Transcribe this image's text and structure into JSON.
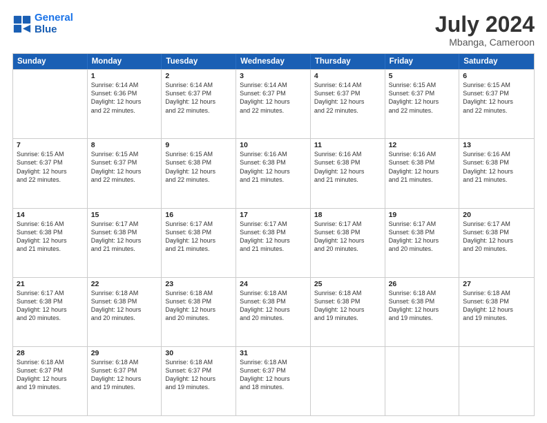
{
  "logo": {
    "line1": "General",
    "line2": "Blue"
  },
  "title": "July 2024",
  "location": "Mbanga, Cameroon",
  "days_of_week": [
    "Sunday",
    "Monday",
    "Tuesday",
    "Wednesday",
    "Thursday",
    "Friday",
    "Saturday"
  ],
  "weeks": [
    [
      {
        "day": "",
        "info": ""
      },
      {
        "day": "1",
        "info": "Sunrise: 6:14 AM\nSunset: 6:36 PM\nDaylight: 12 hours\nand 22 minutes."
      },
      {
        "day": "2",
        "info": "Sunrise: 6:14 AM\nSunset: 6:37 PM\nDaylight: 12 hours\nand 22 minutes."
      },
      {
        "day": "3",
        "info": "Sunrise: 6:14 AM\nSunset: 6:37 PM\nDaylight: 12 hours\nand 22 minutes."
      },
      {
        "day": "4",
        "info": "Sunrise: 6:14 AM\nSunset: 6:37 PM\nDaylight: 12 hours\nand 22 minutes."
      },
      {
        "day": "5",
        "info": "Sunrise: 6:15 AM\nSunset: 6:37 PM\nDaylight: 12 hours\nand 22 minutes."
      },
      {
        "day": "6",
        "info": "Sunrise: 6:15 AM\nSunset: 6:37 PM\nDaylight: 12 hours\nand 22 minutes."
      }
    ],
    [
      {
        "day": "7",
        "info": "Sunrise: 6:15 AM\nSunset: 6:37 PM\nDaylight: 12 hours\nand 22 minutes."
      },
      {
        "day": "8",
        "info": "Sunrise: 6:15 AM\nSunset: 6:37 PM\nDaylight: 12 hours\nand 22 minutes."
      },
      {
        "day": "9",
        "info": "Sunrise: 6:15 AM\nSunset: 6:38 PM\nDaylight: 12 hours\nand 22 minutes."
      },
      {
        "day": "10",
        "info": "Sunrise: 6:16 AM\nSunset: 6:38 PM\nDaylight: 12 hours\nand 21 minutes."
      },
      {
        "day": "11",
        "info": "Sunrise: 6:16 AM\nSunset: 6:38 PM\nDaylight: 12 hours\nand 21 minutes."
      },
      {
        "day": "12",
        "info": "Sunrise: 6:16 AM\nSunset: 6:38 PM\nDaylight: 12 hours\nand 21 minutes."
      },
      {
        "day": "13",
        "info": "Sunrise: 6:16 AM\nSunset: 6:38 PM\nDaylight: 12 hours\nand 21 minutes."
      }
    ],
    [
      {
        "day": "14",
        "info": "Sunrise: 6:16 AM\nSunset: 6:38 PM\nDaylight: 12 hours\nand 21 minutes."
      },
      {
        "day": "15",
        "info": "Sunrise: 6:17 AM\nSunset: 6:38 PM\nDaylight: 12 hours\nand 21 minutes."
      },
      {
        "day": "16",
        "info": "Sunrise: 6:17 AM\nSunset: 6:38 PM\nDaylight: 12 hours\nand 21 minutes."
      },
      {
        "day": "17",
        "info": "Sunrise: 6:17 AM\nSunset: 6:38 PM\nDaylight: 12 hours\nand 21 minutes."
      },
      {
        "day": "18",
        "info": "Sunrise: 6:17 AM\nSunset: 6:38 PM\nDaylight: 12 hours\nand 20 minutes."
      },
      {
        "day": "19",
        "info": "Sunrise: 6:17 AM\nSunset: 6:38 PM\nDaylight: 12 hours\nand 20 minutes."
      },
      {
        "day": "20",
        "info": "Sunrise: 6:17 AM\nSunset: 6:38 PM\nDaylight: 12 hours\nand 20 minutes."
      }
    ],
    [
      {
        "day": "21",
        "info": "Sunrise: 6:17 AM\nSunset: 6:38 PM\nDaylight: 12 hours\nand 20 minutes."
      },
      {
        "day": "22",
        "info": "Sunrise: 6:18 AM\nSunset: 6:38 PM\nDaylight: 12 hours\nand 20 minutes."
      },
      {
        "day": "23",
        "info": "Sunrise: 6:18 AM\nSunset: 6:38 PM\nDaylight: 12 hours\nand 20 minutes."
      },
      {
        "day": "24",
        "info": "Sunrise: 6:18 AM\nSunset: 6:38 PM\nDaylight: 12 hours\nand 20 minutes."
      },
      {
        "day": "25",
        "info": "Sunrise: 6:18 AM\nSunset: 6:38 PM\nDaylight: 12 hours\nand 19 minutes."
      },
      {
        "day": "26",
        "info": "Sunrise: 6:18 AM\nSunset: 6:38 PM\nDaylight: 12 hours\nand 19 minutes."
      },
      {
        "day": "27",
        "info": "Sunrise: 6:18 AM\nSunset: 6:38 PM\nDaylight: 12 hours\nand 19 minutes."
      }
    ],
    [
      {
        "day": "28",
        "info": "Sunrise: 6:18 AM\nSunset: 6:37 PM\nDaylight: 12 hours\nand 19 minutes."
      },
      {
        "day": "29",
        "info": "Sunrise: 6:18 AM\nSunset: 6:37 PM\nDaylight: 12 hours\nand 19 minutes."
      },
      {
        "day": "30",
        "info": "Sunrise: 6:18 AM\nSunset: 6:37 PM\nDaylight: 12 hours\nand 19 minutes."
      },
      {
        "day": "31",
        "info": "Sunrise: 6:18 AM\nSunset: 6:37 PM\nDaylight: 12 hours\nand 18 minutes."
      },
      {
        "day": "",
        "info": ""
      },
      {
        "day": "",
        "info": ""
      },
      {
        "day": "",
        "info": ""
      }
    ]
  ]
}
